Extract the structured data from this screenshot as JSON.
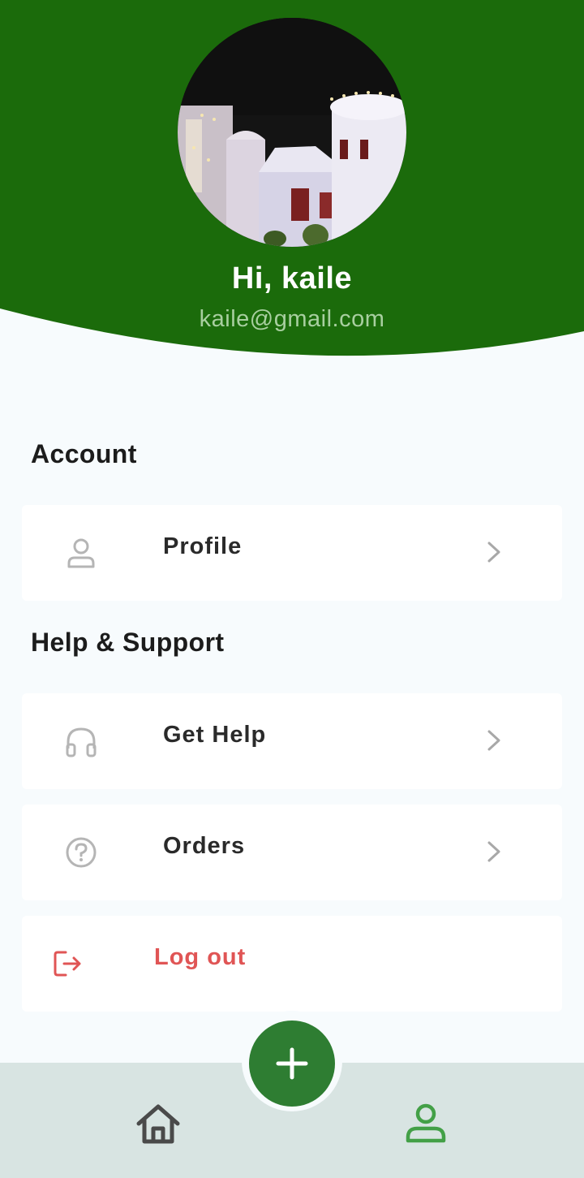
{
  "header": {
    "greeting": "Hi, kaile",
    "email": "kaile@gmail.com",
    "avatar_icon": "profile-photo",
    "background_color": "#1b6b0b"
  },
  "sections": {
    "account": {
      "title": "Account",
      "items": [
        {
          "label": "Profile",
          "icon": "person-icon"
        }
      ]
    },
    "support": {
      "title": "Help & Support",
      "items": [
        {
          "label": "Get Help",
          "icon": "headphones-icon"
        },
        {
          "label": "Orders",
          "icon": "question-circle-icon"
        }
      ]
    },
    "logout": {
      "label": "Log out",
      "icon": "logout-icon",
      "color": "#e05555"
    }
  },
  "bottom_nav": {
    "items": [
      {
        "icon": "home-icon",
        "active": false
      },
      {
        "icon": "person-icon",
        "active": true
      }
    ],
    "fab_icon": "plus-icon",
    "fab_color": "#2e7d32",
    "active_color": "#43a047"
  }
}
